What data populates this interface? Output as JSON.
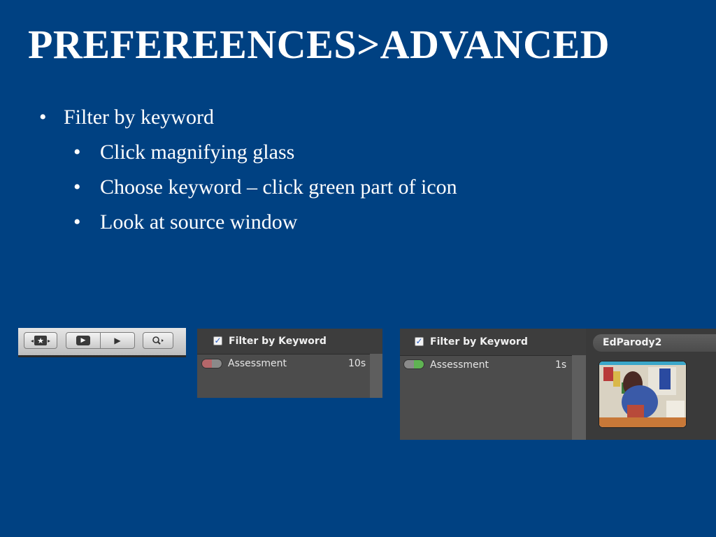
{
  "slide": {
    "title": "PREFEREENCES>ADVANCED",
    "bullets": [
      {
        "text": "Filter by keyword",
        "level": 1
      },
      {
        "text": "Click magnifying glass",
        "level": 2
      },
      {
        "text": "Choose keyword – click green part of icon",
        "level": 2
      },
      {
        "text": "Look at source window",
        "level": 2
      }
    ],
    "bullet_char": "•"
  },
  "toolbar": {
    "icons": [
      "keyword-star-icon",
      "play-full-icon",
      "play-icon",
      "magnifier-icon"
    ],
    "glyphs": {
      "star": "★",
      "play": "▶",
      "search": "⌕",
      "left_arrow": "◂",
      "right_arrow": "▸"
    }
  },
  "filter_panel_1": {
    "checkbox_label": "Filter by Keyword",
    "checked": true,
    "keyword": "Assessment",
    "duration": "10s"
  },
  "filter_panel_2": {
    "checkbox_label": "Filter by Keyword",
    "checked": true,
    "keyword": "Assessment",
    "duration": "1s"
  },
  "source_window": {
    "project_name": "EdParody2"
  },
  "colors": {
    "slide_background": "#004182",
    "text": "#ffffff",
    "panel_background": "#4c4c4c",
    "pill_red": "#b5676a",
    "pill_green": "#5fb352",
    "pill_gray": "#8a8a8a"
  },
  "check_glyph": "✓"
}
